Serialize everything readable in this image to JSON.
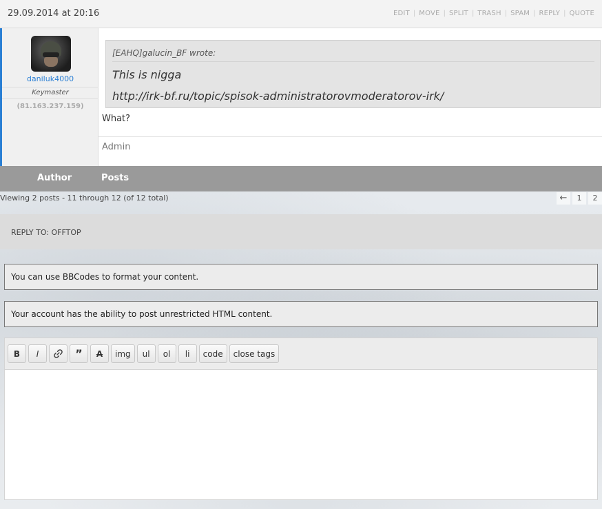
{
  "post": {
    "date": "29.09.2014 at 20:16",
    "admin_links": [
      "EDIT",
      "MOVE",
      "SPLIT",
      "TRASH",
      "SPAM",
      "REPLY",
      "QUOTE"
    ],
    "author": {
      "name": "daniluk4000",
      "role": "Keymaster",
      "ip": "(81.163.237.159)"
    },
    "quote": {
      "author": "[EAHQ]galucin_BF wrote:",
      "line1": "This is nigga",
      "line2": "http://irk-bf.ru/topic/spisok-administratorovmoderatorov-irk/"
    },
    "text": "What?",
    "signature": "Admin"
  },
  "list_footer": {
    "author_label": "Author",
    "posts_label": "Posts"
  },
  "pagination": {
    "viewing": "Viewing 2 posts - 11 through 12 (of 12 total)",
    "prev": "←",
    "pages": [
      "1",
      "2"
    ]
  },
  "reply": {
    "title": "REPLY TO: OFFTOP",
    "notice_bbcodes": "You can use BBCodes to format your content.",
    "notice_html": "Your account has the ability to post unrestricted HTML content."
  },
  "toolbar": {
    "bold": "B",
    "italic": "I",
    "link_icon": "link-icon",
    "quote": "”",
    "strike": "A",
    "img": "img",
    "ul": "ul",
    "ol": "ol",
    "li": "li",
    "code": "code",
    "close_tags": "close tags"
  },
  "colors": {
    "accent": "#2a7fd4",
    "footer_bar": "#9a9a9a"
  }
}
